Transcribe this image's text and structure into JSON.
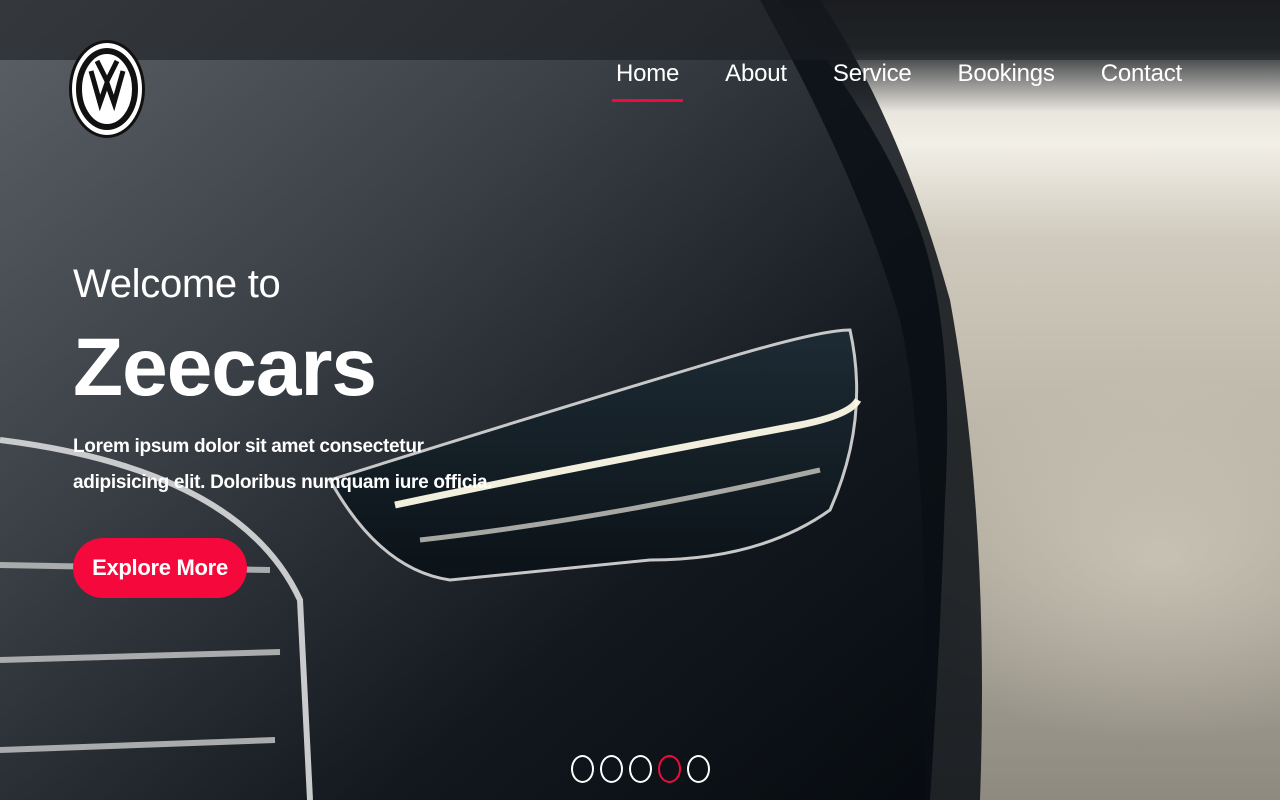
{
  "nav": {
    "items": [
      {
        "label": "Home",
        "active": true
      },
      {
        "label": "About",
        "active": false
      },
      {
        "label": "Service",
        "active": false
      },
      {
        "label": "Bookings",
        "active": false
      },
      {
        "label": "Contact",
        "active": false
      }
    ]
  },
  "logo": {
    "icon": "vw-logo-icon"
  },
  "hero": {
    "welcome": "Welcome to",
    "brand": "Zeecars",
    "lead": "Lorem ipsum dolor sit amet consectetur adipisicing elit. Doloribus numquam iure officia.",
    "cta_label": "Explore More"
  },
  "carousel": {
    "slide_count": 5,
    "active_index": 3
  },
  "colors": {
    "accent": "#f5093c",
    "text": "#ffffff"
  }
}
